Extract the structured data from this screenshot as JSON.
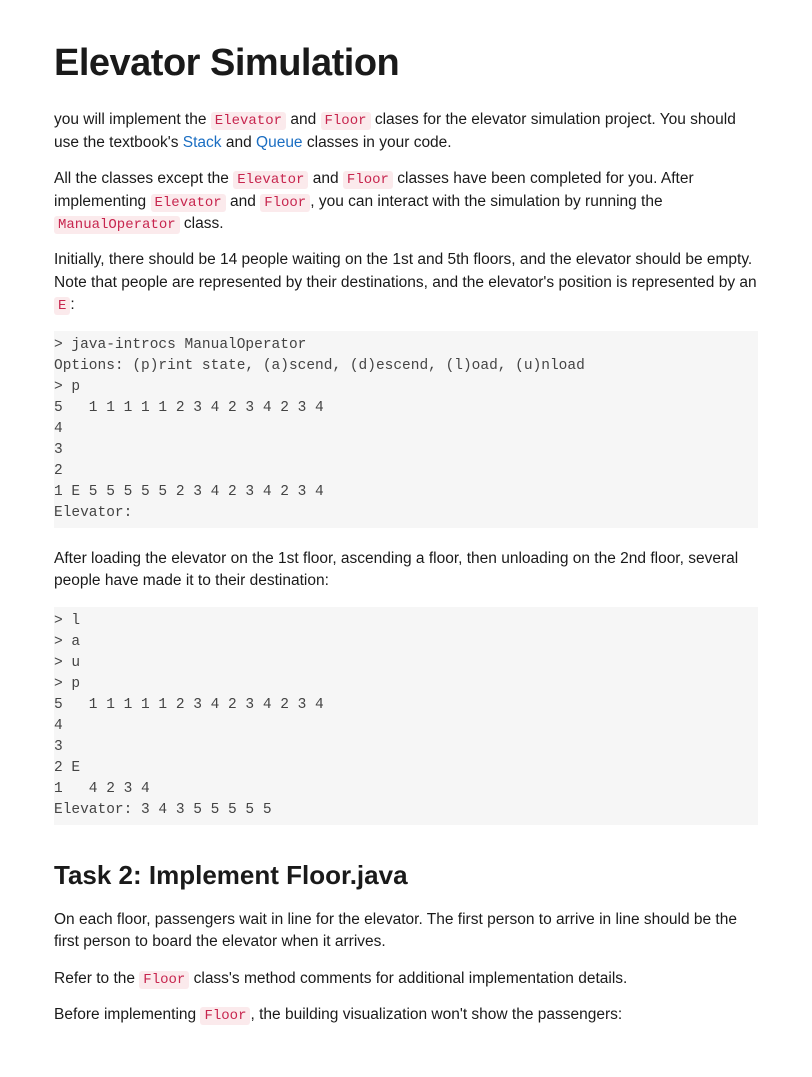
{
  "title": "Elevator Simulation",
  "p1": {
    "t1": "you will implement the ",
    "c1": "Elevator",
    "t2": " and ",
    "c2": "Floor",
    "t3": " clases for the elevator simulation project. You should use the textbook's ",
    "link1": "Stack",
    "t4": " and ",
    "link2": "Queue",
    "t5": " classes in your code."
  },
  "p2": {
    "t1": "All the classes except the ",
    "c1": "Elevator",
    "t2": " and ",
    "c2": "Floor",
    "t3": " classes have been completed for you. After implementing ",
    "c3": "Elevator",
    "t4": " and ",
    "c4": "Floor",
    "t5": ", you can interact with the simulation by running the ",
    "c5": "ManualOperator",
    "t6": " class."
  },
  "p3": {
    "t1": "Initially, there should be 14 people waiting on the 1st and 5th floors, and the elevator should be empty. Note that people are represented by their destinations, and the elevator's position is represented by an ",
    "c1": "E",
    "t2": ":"
  },
  "code1": "> java-introcs ManualOperator\nOptions: (p)rint state, (a)scend, (d)escend, (l)oad, (u)nload\n> p\n5   1 1 1 1 1 2 3 4 2 3 4 2 3 4\n4\n3\n2\n1 E 5 5 5 5 5 2 3 4 2 3 4 2 3 4\nElevator:",
  "p4": "After loading the elevator on the 1st floor, ascending a floor, then unloading on the 2nd floor, several people have made it to their destination:",
  "code2": "> l\n> a\n> u\n> p\n5   1 1 1 1 1 2 3 4 2 3 4 2 3 4\n4\n3\n2 E\n1   4 2 3 4\nElevator: 3 4 3 5 5 5 5 5",
  "h2": "Task 2: Implement Floor.java",
  "p5": "On each floor, passengers wait in line for the elevator. The first person to arrive in line should be the first person to board the elevator when it arrives.",
  "p6": {
    "t1": "Refer to the ",
    "c1": "Floor",
    "t2": " class's method comments for additional implementation details."
  },
  "p7": {
    "t1": "Before implementing ",
    "c1": "Floor",
    "t2": ", the building visualization won't show the passengers:"
  }
}
